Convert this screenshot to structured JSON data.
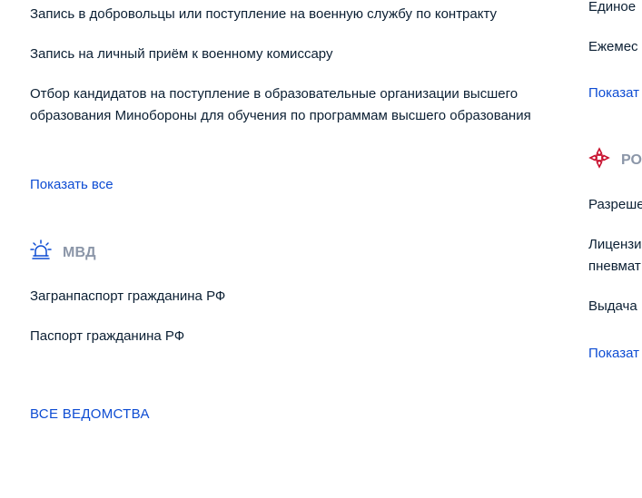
{
  "left": {
    "mo_services": [
      "Запись в добровольцы или поступление на военную службу по контракту",
      "Запись на личный приём к военному комиссару",
      "Отбор кандидатов на поступление в образовательные организации высшего образования Минобороны для обучения по программам высшего образования"
    ],
    "mo_show_all": "Показать все",
    "mvd": {
      "title": "МВД",
      "icon": "siren-icon",
      "services": [
        "Загранпаспорт гражданина РФ",
        "Паспорт гражданина РФ"
      ]
    },
    "all_departments": "ВСЕ ВЕДОМСТВА"
  },
  "right": {
    "items_top": [
      "Единое",
      "Ежемес"
    ],
    "show_all_1": "Показат",
    "dept": {
      "title": "РО",
      "icon": "rosgvardia-icon",
      "color": "#c8102e"
    },
    "items_bottom": [
      "Разреше",
      "Лицензи",
      "пневмат",
      "Выдача"
    ],
    "show_all_2": "Показат"
  },
  "colors": {
    "link": "#0d4cd3",
    "text": "#0b1f33",
    "dept_title": "#8b96a8",
    "icon_blue": "#0d4cd3",
    "icon_red": "#c8102e"
  }
}
